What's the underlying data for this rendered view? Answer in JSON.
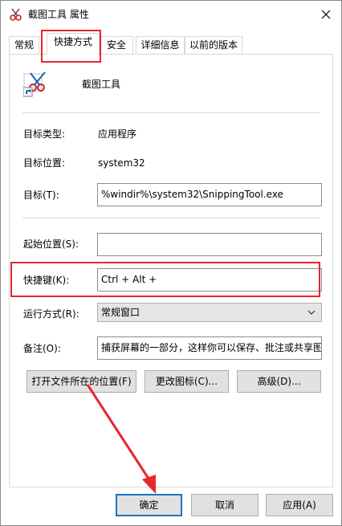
{
  "window": {
    "title": "截图工具 属性",
    "close_glyph": "✕"
  },
  "tabs": [
    {
      "label": "常规",
      "active": false
    },
    {
      "label": "快捷方式",
      "active": true
    },
    {
      "label": "安全",
      "active": false
    },
    {
      "label": "详细信息",
      "active": false
    },
    {
      "label": "以前的版本",
      "active": false
    }
  ],
  "shortcut": {
    "app_name": "截图工具",
    "target_type_label": "目标类型:",
    "target_type_value": "应用程序",
    "target_location_label": "目标位置:",
    "target_location_value": "system32",
    "target_label": "目标(T):",
    "target_value": "%windir%\\system32\\SnippingTool.exe",
    "start_in_label": "起始位置(S):",
    "start_in_value": "",
    "hotkey_label": "快捷键(K):",
    "hotkey_value": "Ctrl + Alt + ",
    "run_label": "运行方式(R):",
    "run_value": "常规窗口",
    "comment_label": "备注(O):",
    "comment_value": "捕获屏幕的一部分，这样你可以保存、批注或共享图"
  },
  "buttons": {
    "open_location": "打开文件所在的位置(F)",
    "change_icon": "更改图标(C)...",
    "advanced": "高级(D)...",
    "ok": "确定",
    "cancel": "取消",
    "apply": "应用(A)"
  },
  "colors": {
    "highlight": "#e8262d",
    "default_button_border": "#1a73c9"
  }
}
